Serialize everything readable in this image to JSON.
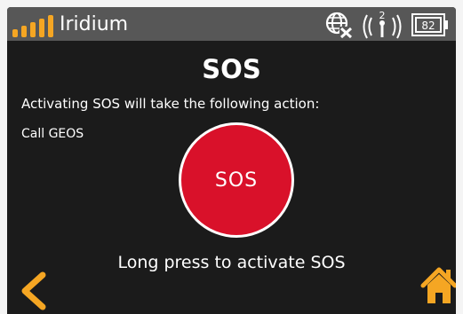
{
  "status_bar": {
    "network_name": "Iridium",
    "signal_bars": 5,
    "satellite_count": "2",
    "battery_level": "82",
    "icons": [
      "signal-bars-icon",
      "globe-no-gps-icon",
      "satellite-signal-icon",
      "battery-icon"
    ]
  },
  "main": {
    "title": "SOS",
    "action_intro": "Activating SOS will take the following action:",
    "action_item": "Call GEOS",
    "sos_button_label": "SOS",
    "instruction": "Long press to activate SOS"
  },
  "nav": {
    "back_icon": "chevron-left-icon",
    "home_icon": "home-icon"
  },
  "colors": {
    "background": "#1b1b1b",
    "status_bar": "#575757",
    "accent": "#f5a623",
    "sos_red": "#d9112a",
    "text": "#ffffff"
  }
}
